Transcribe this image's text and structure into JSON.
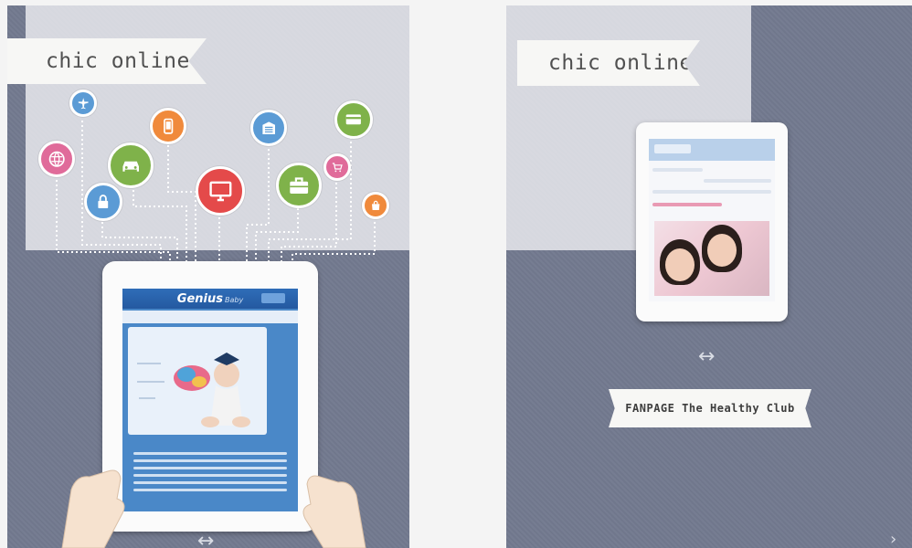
{
  "left_page": {
    "banner": "chic online",
    "app": {
      "title": "Genius",
      "title_suffix": "Baby"
    }
  },
  "right_page": {
    "banner": "chic online",
    "fanpage_label": "FANPAGE The Healthy Club"
  },
  "icons": [
    "airplane-icon",
    "globe-icon",
    "car-icon",
    "lock-icon",
    "phone-icon",
    "monitor-icon",
    "building-icon",
    "briefcase-icon",
    "credit-card-icon",
    "cart-icon",
    "bag-icon"
  ],
  "colors": {
    "page_bg": "#737a8f",
    "banner_bg": "#f7f7f5",
    "icon_blue": "#5b9bd5",
    "icon_pink": "#e06b9a",
    "icon_green": "#7fb24a",
    "icon_orange": "#f08a3c",
    "icon_red": "#e44a4a"
  }
}
